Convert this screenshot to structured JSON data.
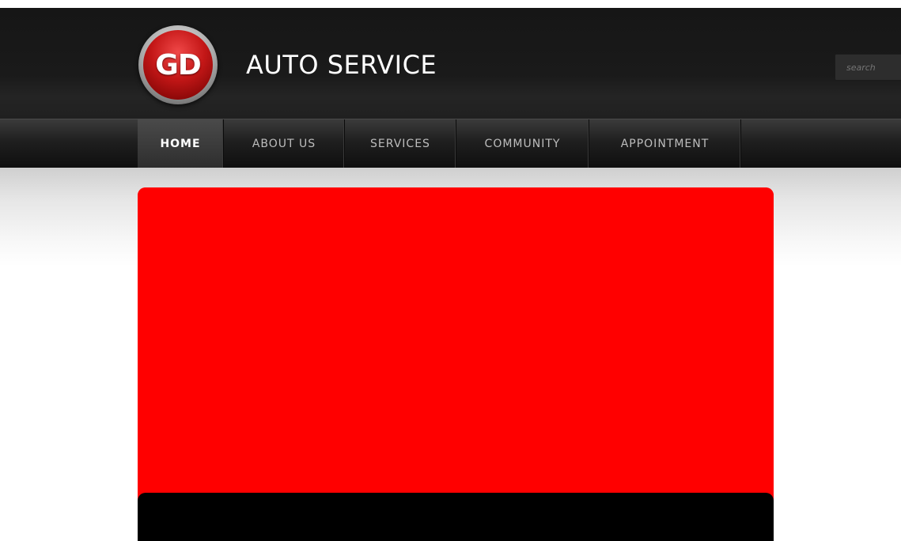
{
  "header": {
    "logo_text": "GD",
    "brand_name": "AUTO SERVICE",
    "search_placeholder": "search"
  },
  "nav": {
    "items": [
      {
        "label": "HOME",
        "active": true
      },
      {
        "label": "ABOUT US",
        "active": false
      },
      {
        "label": "SERVICES",
        "active": false
      },
      {
        "label": "COMMUNITY",
        "active": false
      },
      {
        "label": "APPOINTMENT",
        "active": false
      }
    ]
  },
  "slider": {
    "caption_text": ""
  },
  "colors": {
    "header_bg": "#161616",
    "nav_bg": "#1f1f1f",
    "logo_red": "#c41717",
    "slider_red": "#ff0000",
    "caption_black": "#000000"
  },
  "icons": {
    "logo": "gd-logo-badge"
  }
}
